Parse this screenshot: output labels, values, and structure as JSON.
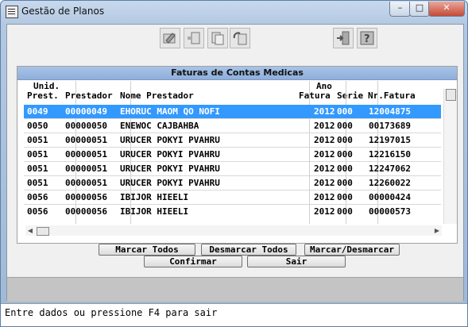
{
  "window": {
    "title": "Gestão de Planos"
  },
  "grid": {
    "title": "Faturas de Contas Medicas",
    "headers": {
      "unid_line1": "Unid.",
      "unid_line2": "Prest.",
      "prestador": "Prestador",
      "nome": "Nome Prestador",
      "ano_line1": "Ano",
      "ano_line2": "Fatura",
      "serie": "Serie",
      "nr": "Nr.Fatura"
    },
    "rows": [
      {
        "unid": "0049",
        "prest": "00000049",
        "nome": "EHORUC MAOM QO NOFI",
        "ano": "2012",
        "serie": "000",
        "nr": "12004875",
        "selected": true
      },
      {
        "unid": "0050",
        "prest": "00000050",
        "nome": "ENEWOC CAJBAHBA",
        "ano": "2012",
        "serie": "000",
        "nr": "00173689",
        "selected": false
      },
      {
        "unid": "0051",
        "prest": "00000051",
        "nome": "URUCER POKYI PVAHRU",
        "ano": "2012",
        "serie": "000",
        "nr": "12197015",
        "selected": false
      },
      {
        "unid": "0051",
        "prest": "00000051",
        "nome": "URUCER POKYI PVAHRU",
        "ano": "2012",
        "serie": "000",
        "nr": "12216150",
        "selected": false
      },
      {
        "unid": "0051",
        "prest": "00000051",
        "nome": "URUCER POKYI PVAHRU",
        "ano": "2012",
        "serie": "000",
        "nr": "12247062",
        "selected": false
      },
      {
        "unid": "0051",
        "prest": "00000051",
        "nome": "URUCER POKYI PVAHRU",
        "ano": "2012",
        "serie": "000",
        "nr": "12260022",
        "selected": false
      },
      {
        "unid": "0056",
        "prest": "00000056",
        "nome": "IBIJOR HIEELI",
        "ano": "2012",
        "serie": "000",
        "nr": "00000424",
        "selected": false
      },
      {
        "unid": "0056",
        "prest": "00000056",
        "nome": "IBIJOR HIEELI",
        "ano": "2012",
        "serie": "000",
        "nr": "00000573",
        "selected": false
      }
    ]
  },
  "buttons": {
    "marcar_todos": "Marcar Todos",
    "desmarcar_todos": "Desmarcar Todos",
    "marcar_desmarcar": "Marcar/Desmarcar",
    "confirmar": "Confirmar",
    "sair": "Sair"
  },
  "status": {
    "text": "Entre dados ou pressione F4 para sair"
  },
  "colors": {
    "selection": "#3399ff",
    "grid_title": "#a9c3e6",
    "close_button": "#c74a36"
  },
  "icons": [
    "app-icon",
    "minimize-icon",
    "maximize-icon",
    "close-icon",
    "edit-icon",
    "print-icon",
    "copy-icon",
    "refresh-icon",
    "exit-door-icon",
    "help-icon"
  ]
}
